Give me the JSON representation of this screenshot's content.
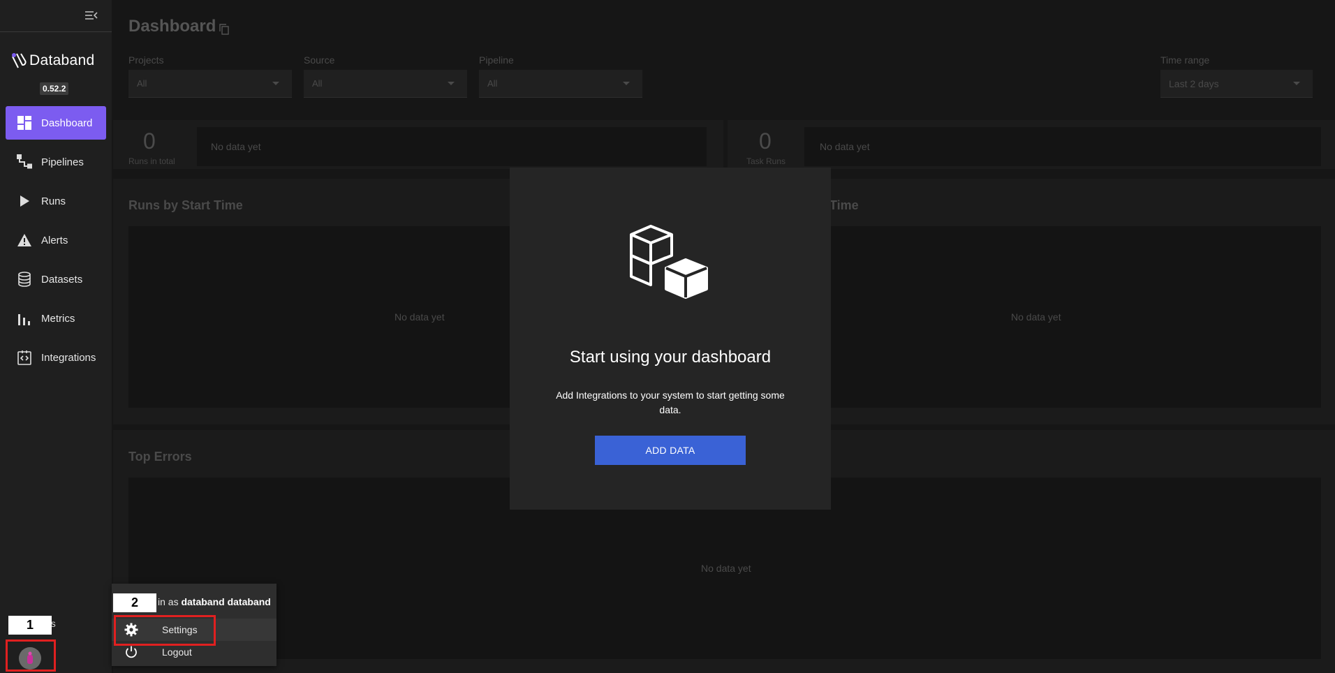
{
  "sidebar": {
    "logo_text": "Databand",
    "version": "0.52.2",
    "items": [
      {
        "label": "Dashboard",
        "icon": "dashboard-icon"
      },
      {
        "label": "Pipelines",
        "icon": "pipelines-icon"
      },
      {
        "label": "Runs",
        "icon": "play-icon"
      },
      {
        "label": "Alerts",
        "icon": "warning-icon"
      },
      {
        "label": "Datasets",
        "icon": "database-icon"
      },
      {
        "label": "Metrics",
        "icon": "bar-chart-icon"
      },
      {
        "label": "Integrations",
        "icon": "integrations-icon"
      }
    ],
    "docs_label": "ocs"
  },
  "annotations": {
    "label_1": "1",
    "label_2": "2"
  },
  "main": {
    "title": "Dashboard",
    "filters": [
      {
        "label": "Projects",
        "value": "All"
      },
      {
        "label": "Source",
        "value": "All"
      },
      {
        "label": "Pipeline",
        "value": "All"
      },
      {
        "label": "Time range",
        "value": "Last 2 days"
      }
    ],
    "stats": [
      {
        "value": "0",
        "label": "Runs in total",
        "chart_text": "No data yet"
      },
      {
        "value": "0",
        "label": "Task Runs",
        "chart_text": "No data yet"
      }
    ],
    "runs_by_start_time": {
      "title": "Runs by Start Time",
      "nodata": "No data yet"
    },
    "right_chart": {
      "title_fragment": "Time",
      "nodata": "No data yet"
    },
    "top_errors": {
      "title": "Top Errors",
      "nodata": "No data yet"
    }
  },
  "dialog": {
    "icon": "cubes-icon",
    "title": "Start using your dashboard",
    "text": "Add Integrations to your system to start getting some data.",
    "button": "ADD DATA"
  },
  "user_menu": {
    "prefix": "in as",
    "username": "databand databand",
    "settings": "Settings",
    "logout": "Logout"
  },
  "colors": {
    "accent": "#7c5cf0",
    "button": "#3a62d6",
    "highlight": "#e02020"
  }
}
